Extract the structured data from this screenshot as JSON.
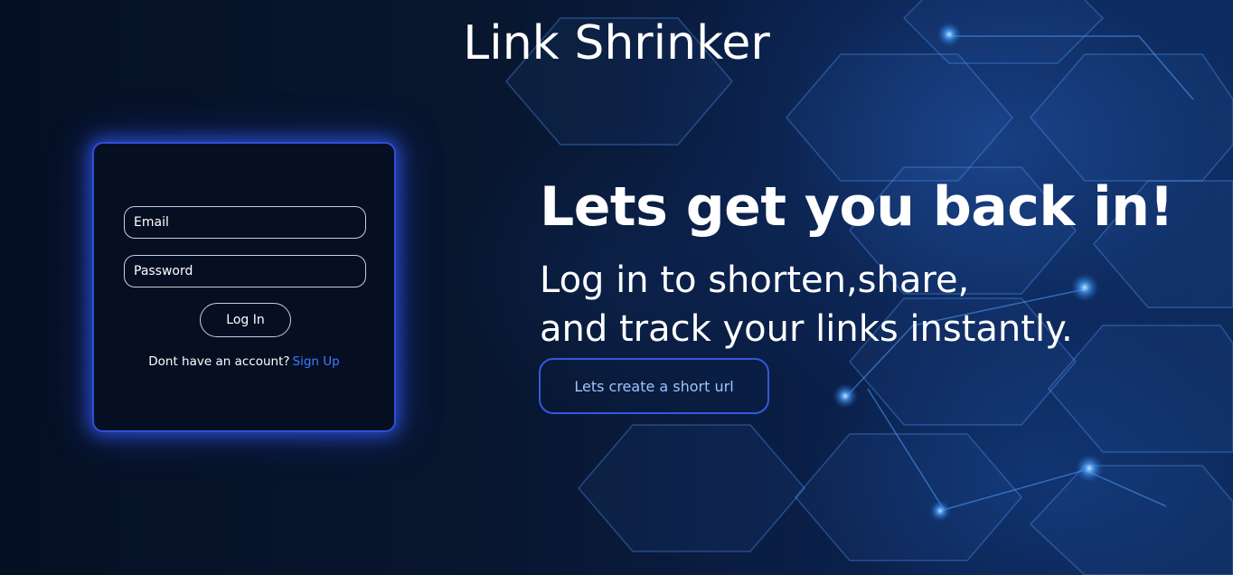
{
  "header": {
    "title": "Link Shrinker"
  },
  "login": {
    "email_placeholder": "Email",
    "password_placeholder": "Password",
    "login_label": "Log In",
    "signup_prompt": "Dont have an account?",
    "signup_link": "Sign Up"
  },
  "hero": {
    "heading": "Lets get you back in!",
    "subline_1": "Log in to shorten,share,",
    "subline_2": "and track your links instantly.",
    "cta_label": "Lets create a short url"
  },
  "theme": {
    "background": "#071228",
    "accent_border": "#2f4fd6",
    "link_color": "#3f7bff",
    "cta_text_color": "#9ec4ff"
  }
}
